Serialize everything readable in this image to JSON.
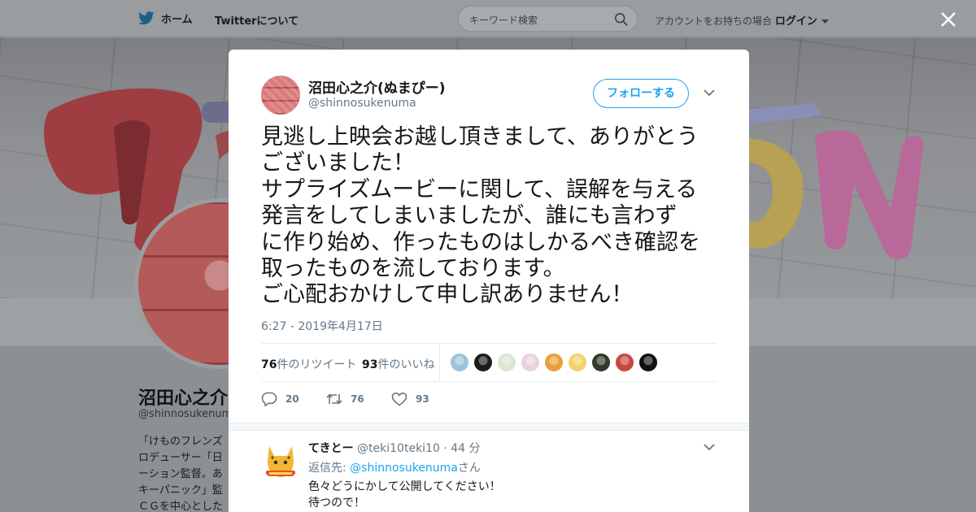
{
  "nav": {
    "home_label": "ホーム",
    "about_label": "Twitterについて",
    "search_placeholder": "キーワード検索",
    "account_prompt": "アカウントをお持ちの場合",
    "login_label": "ログイン",
    "icons": [
      "twitter-bird-icon",
      "search-icon",
      "chevron-down-icon",
      "close-icon"
    ]
  },
  "profile_bg": {
    "name": "沼田心之介(",
    "handle": "@shinnosukenuma",
    "bio_lines": [
      "「けものフレンズ",
      "ロデューサー「日",
      "ーション監督。あ",
      "キーパニック」監",
      "ＣＧを中心とした"
    ]
  },
  "tweet": {
    "author_name": "沼田心之介(ぬまぴー)",
    "author_handle": "@shinnosukenuma",
    "follow_label": "フォローする",
    "text_lines": [
      "見逃し上映会お越し頂きまして、ありがとう",
      "ございました！",
      "サプライズムービーに関して、誤解を与える",
      "発言をしてしまいましたが、誰にも言わず",
      "に作り始め、作ったものはしかるべき確認を",
      "取ったものを流しております。",
      "ご心配おかけして申し訳ありません！"
    ],
    "timestamp": "6:27 - 2019年4月17日",
    "retweets_count": "76",
    "retweets_suffix": "件のリツイート",
    "likes_count": "93",
    "likes_suffix": "件のいいね",
    "liker_colors": [
      "#9dc3d9",
      "#1c1c1c",
      "#d9e6d2",
      "#e8d3da",
      "#e8a03a",
      "#f2d36b",
      "#2f3a2a",
      "#c9473f",
      "#111111"
    ],
    "actions": {
      "reply_count": "20",
      "retweet_count": "76",
      "like_count": "93"
    }
  },
  "reply": {
    "name": "てきとー",
    "handle": "@teki10teki10",
    "separator": "·",
    "time": "44 分",
    "reply_to_prefix": "返信先:",
    "reply_to_handle": "@shinnosukenuma",
    "reply_to_suffix": "さん",
    "body_lines": [
      "色々どうにかして公開してください！",
      "待つので！"
    ]
  },
  "colors": {
    "accent": "#1da1f2",
    "text_primary": "#14171a",
    "text_secondary": "#657786"
  }
}
